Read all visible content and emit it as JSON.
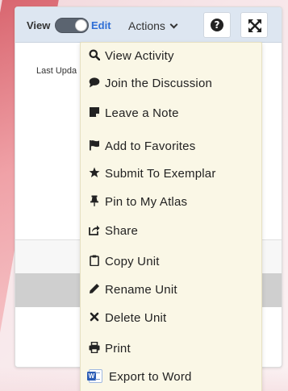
{
  "toolbar": {
    "view_label": "View",
    "edit_label": "Edit",
    "actions_label": "Actions",
    "help_icon_name": "question-circle-icon",
    "expand_icon_name": "expand-arrows-icon"
  },
  "page": {
    "last_updated_label": "Last Upda"
  },
  "menu": {
    "items": [
      {
        "label": "View Activity",
        "icon": "search-icon"
      },
      {
        "label": "Join the Discussion",
        "icon": "comment-icon"
      },
      {
        "label": "Leave a Note",
        "icon": "sticky-note-icon"
      },
      {
        "label": "Add to Favorites",
        "icon": "flag-icon"
      },
      {
        "label": "Submit To Exemplar",
        "icon": "star-icon"
      },
      {
        "label": "Pin to My Atlas",
        "icon": "thumbtack-icon"
      },
      {
        "label": "Share",
        "icon": "share-icon"
      },
      {
        "label": "Copy Unit",
        "icon": "clipboard-icon"
      },
      {
        "label": "Rename Unit",
        "icon": "pencil-icon"
      },
      {
        "label": "Delete Unit",
        "icon": "times-icon"
      },
      {
        "label": "Print",
        "icon": "print-icon"
      },
      {
        "label": "Export to Word",
        "icon": "word-icon"
      }
    ]
  },
  "colors": {
    "toolbar_bg": "#dde6f1",
    "menu_bg": "#faf7e6",
    "edit_link": "#2f6fd6",
    "toggle_bg": "#5b6470"
  }
}
